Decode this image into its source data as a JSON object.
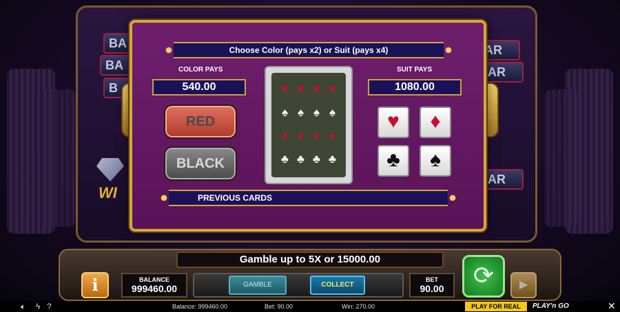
{
  "background": {
    "reel_fragments": [
      "BA",
      "BA",
      "B",
      "AR",
      "AR",
      "AR"
    ],
    "wild_fragment": "WI"
  },
  "gamble": {
    "title": "Choose Color (pays x2) or Suit (pays x4)",
    "color_pays_label": "COLOR PAYS",
    "color_pays_value": "540.00",
    "suit_pays_label": "SUIT PAYS",
    "suit_pays_value": "1080.00",
    "red_label": "RED",
    "black_label": "BLACK",
    "previous_cards_label": "PREVIOUS CARDS",
    "card_back_pattern": [
      "♥",
      "♥",
      "♥",
      "♥",
      "♠",
      "♠",
      "♠",
      "♠",
      "♦",
      "♦",
      "♦",
      "♦",
      "♣",
      "♣",
      "♣",
      "♣"
    ],
    "suits": [
      {
        "name": "hearts",
        "symbol": "♥",
        "color": "#c8102e"
      },
      {
        "name": "diamonds",
        "symbol": "♦",
        "color": "#c8102e"
      },
      {
        "name": "clubs",
        "symbol": "♣",
        "color": "#111111"
      },
      {
        "name": "spades",
        "symbol": "♠",
        "color": "#111111"
      }
    ]
  },
  "controls": {
    "gamble_banner": "Gamble up to 5X or 15000.00",
    "info_icon": "i",
    "balance_label": "BALANCE",
    "balance_value": "999460.00",
    "gamble_button": "GAMBLE",
    "collect_button": "COLLECT",
    "bet_label": "BET",
    "bet_value": "90.00",
    "spin_icon": "refresh-icon",
    "autoplay_icon": "autoplay-icon"
  },
  "footer": {
    "balance_text": "Balance: 999460.00",
    "bet_text": "Bet: 90.00",
    "win_text": "Win: 270.00",
    "play_for_real": "PLAY FOR REAL",
    "brand": "PLAY'n GO",
    "close": "✕"
  },
  "colors": {
    "panel": "#6e1f6c",
    "gold": "#d8a838",
    "navy": "#1a1258",
    "play_for_real": "#f2c718",
    "spin_green": "#3fc04a"
  }
}
